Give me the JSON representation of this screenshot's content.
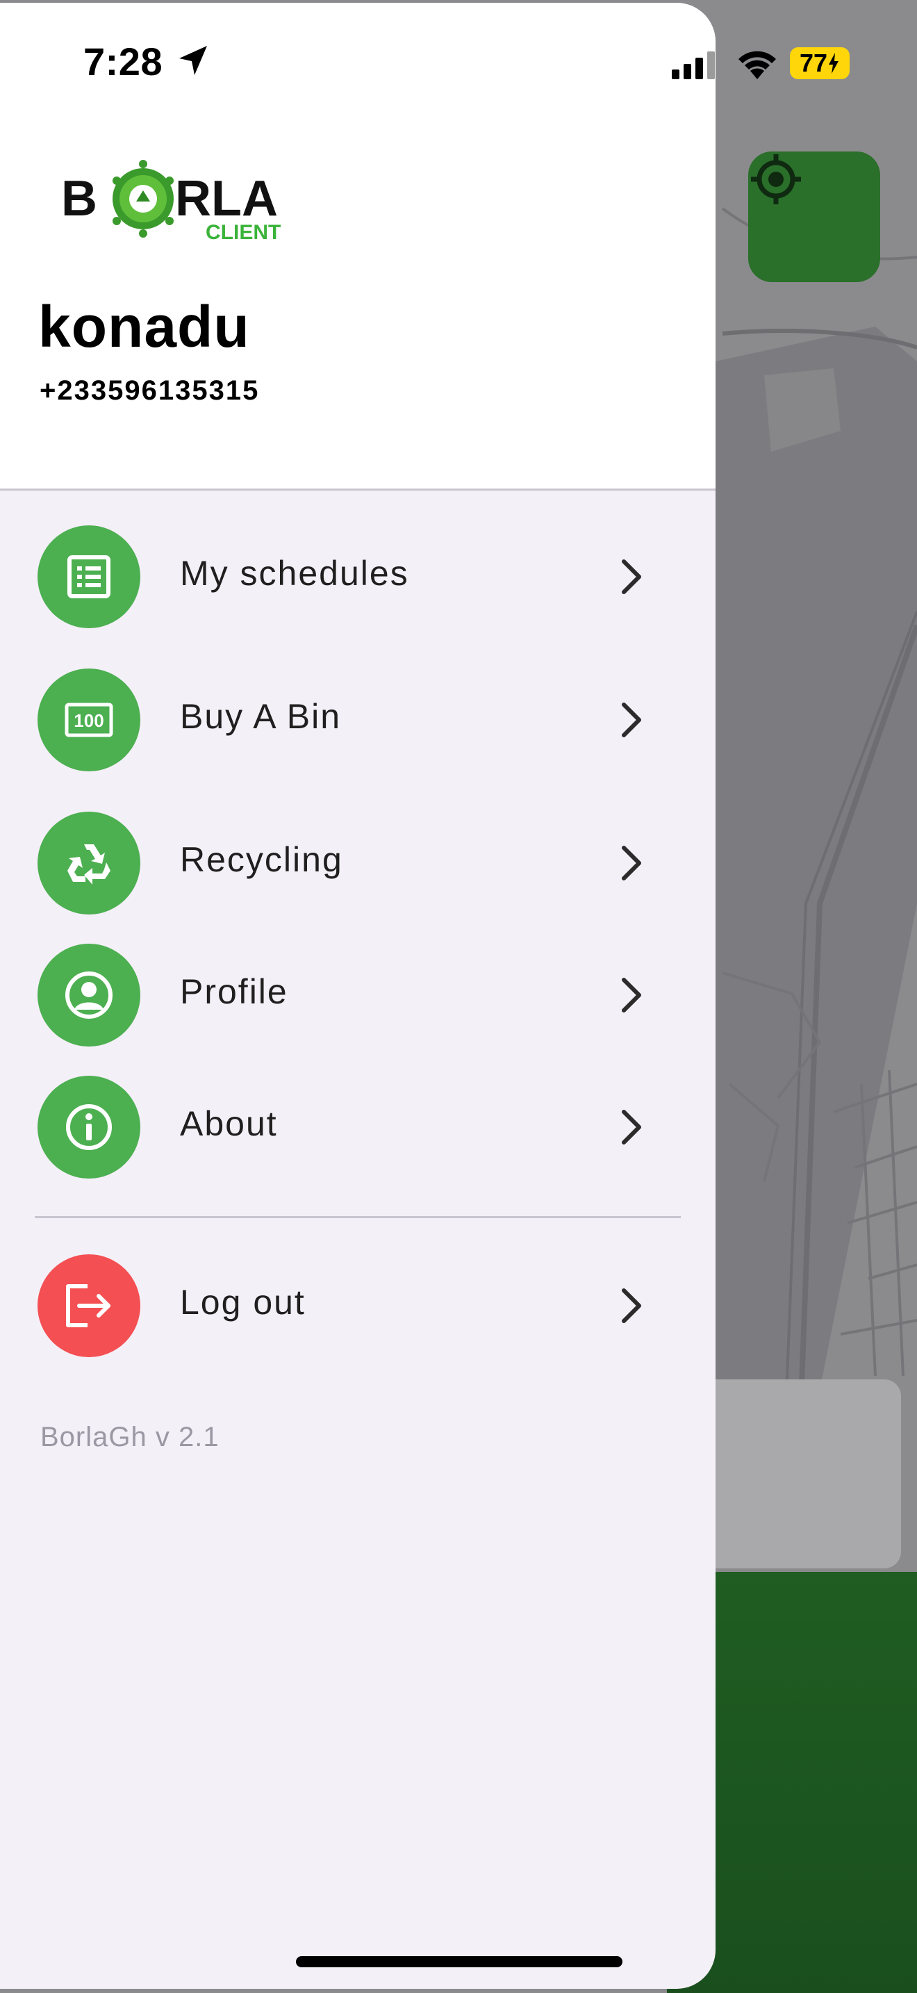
{
  "status_bar": {
    "time": "7:28",
    "battery": "77"
  },
  "brand": {
    "logo_text": "BORLA",
    "logo_sub": "CLIENT",
    "green": "#4caf50",
    "red": "#f44f52"
  },
  "user": {
    "name": "konadu",
    "phone": "+233596135315"
  },
  "menu": {
    "items": [
      {
        "label": "My schedules",
        "icon": "list-icon"
      },
      {
        "label": "Buy A Bin",
        "icon": "bin-icon"
      },
      {
        "label": "Recycling",
        "icon": "recycle-icon"
      },
      {
        "label": "Profile",
        "icon": "user-icon"
      },
      {
        "label": "About",
        "icon": "info-icon"
      }
    ],
    "logout": {
      "label": "Log out",
      "icon": "logout-icon"
    }
  },
  "footer": {
    "version": "BorlaGh v 2.1"
  }
}
